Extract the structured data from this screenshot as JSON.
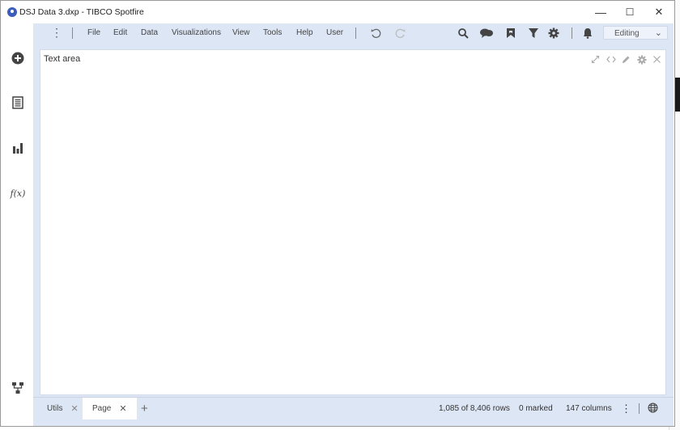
{
  "window": {
    "title": "DSJ Data 3.dxp - TIBCO Spotfire",
    "minimize": "—",
    "maximize": "☐",
    "close": "✕"
  },
  "menu": {
    "items": [
      "File",
      "Edit",
      "Data",
      "Visualizations",
      "View",
      "Tools",
      "Help",
      "User"
    ],
    "mode": "Editing"
  },
  "panel": {
    "title": "Text area"
  },
  "tabs": [
    {
      "label": "Utils",
      "active": false
    },
    {
      "label": "Page",
      "active": true
    }
  ],
  "add_tab": "+",
  "status": {
    "rows": "1,085 of 8,406 rows",
    "marked": "0 marked",
    "columns": "147 columns"
  },
  "sidebar": {
    "fx_label": "f(x)"
  },
  "colors": {
    "accent": "#dde6f5",
    "app_icon": "#3d5dbd"
  }
}
